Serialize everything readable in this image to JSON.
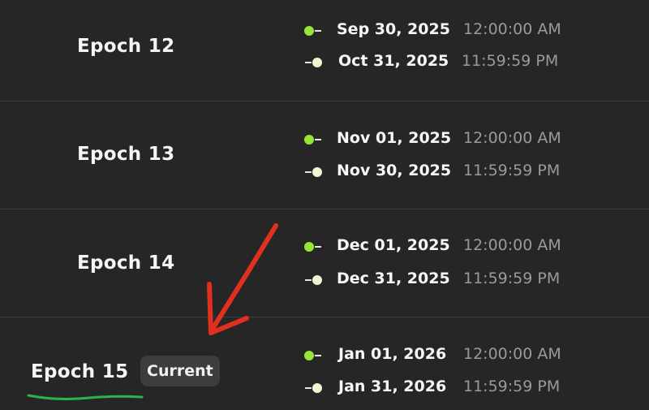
{
  "accents": {
    "start_dot": "#97e534",
    "end_dot": "#f4f6d2",
    "annotation_arrow": "#e0301e",
    "annotation_underline": "#2fb24a"
  },
  "epochs": [
    {
      "name": "Epoch 12",
      "start": {
        "date": "Sep 30, 2025",
        "time": "12:00:00 AM",
        "icon": "start-dot-icon"
      },
      "end": {
        "date": "Oct 31, 2025",
        "time": "11:59:59 PM",
        "icon": "end-dot-icon"
      }
    },
    {
      "name": "Epoch 13",
      "start": {
        "date": "Nov 01, 2025",
        "time": "12:00:00 AM",
        "icon": "start-dot-icon"
      },
      "end": {
        "date": "Nov 30, 2025",
        "time": "11:59:59 PM",
        "icon": "end-dot-icon"
      }
    },
    {
      "name": "Epoch 14",
      "start": {
        "date": "Dec 01, 2025",
        "time": "12:00:00 AM",
        "icon": "start-dot-icon"
      },
      "end": {
        "date": "Dec 31, 2025",
        "time": "11:59:59 PM",
        "icon": "end-dot-icon"
      }
    },
    {
      "name": "Epoch 15",
      "badge": "Current",
      "start": {
        "date": "Jan 01, 2026",
        "time": "12:00:00 AM",
        "icon": "start-dot-icon"
      },
      "end": {
        "date": "Jan 31, 2026",
        "time": "11:59:59 PM",
        "icon": "end-dot-icon"
      }
    }
  ]
}
